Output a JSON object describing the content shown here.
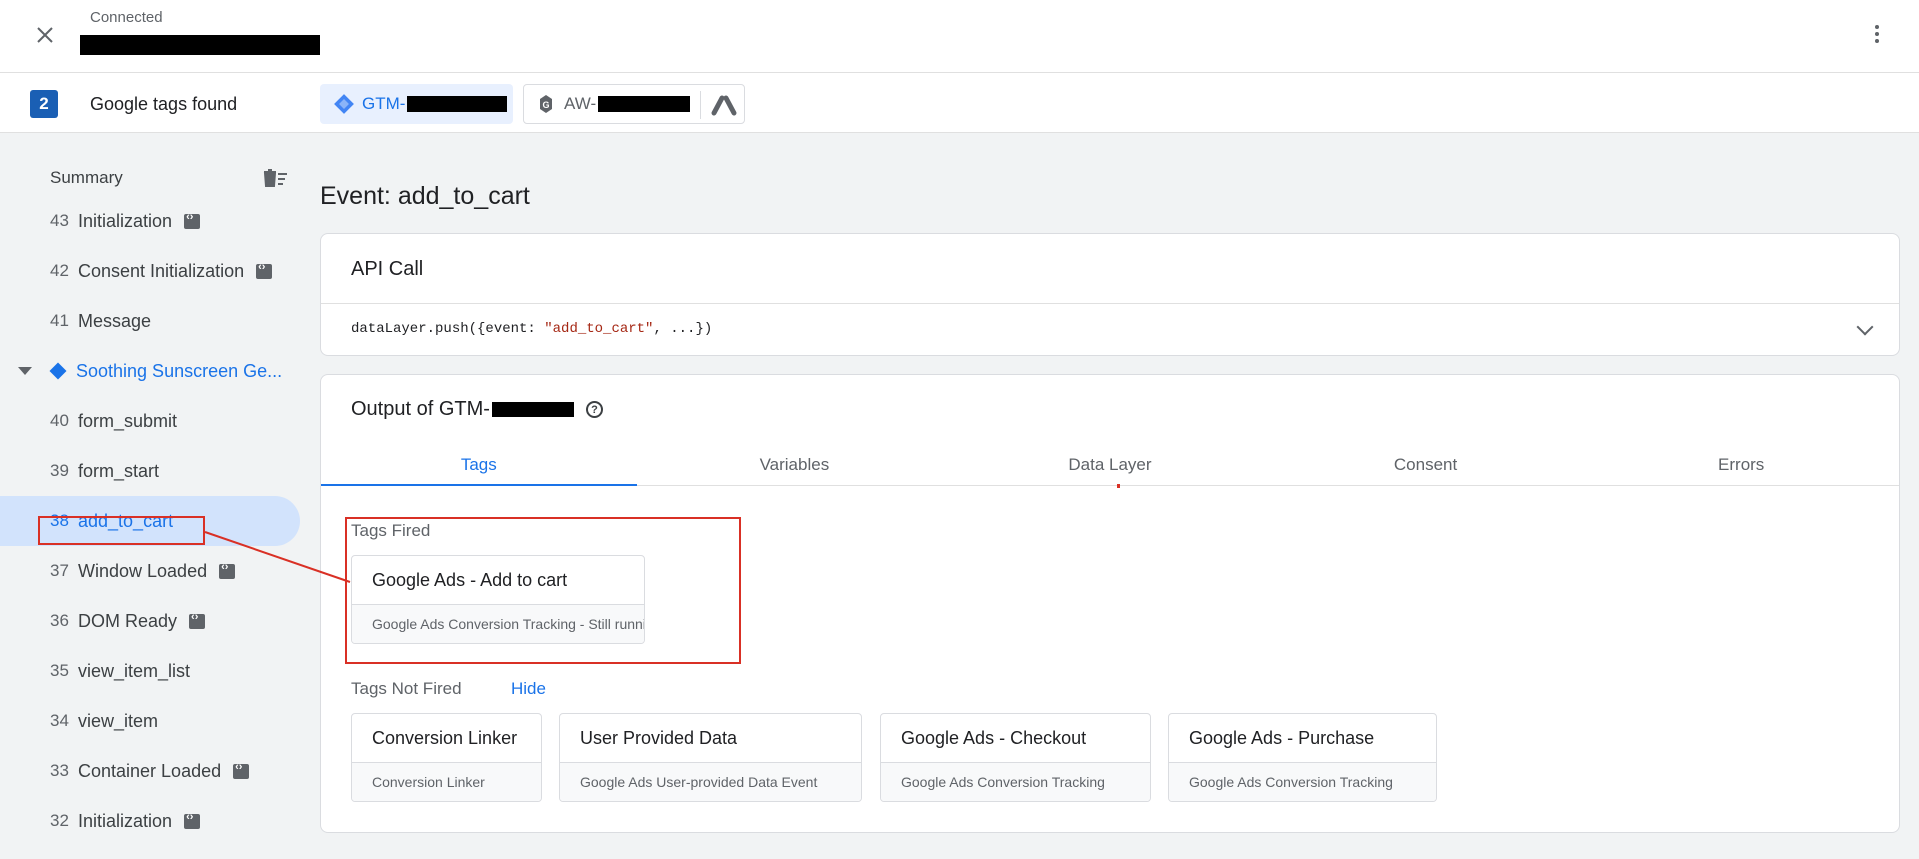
{
  "header": {
    "status": "Connected"
  },
  "tag_bar": {
    "count": "2",
    "label": "Google tags found",
    "chips": [
      {
        "prefix": "GTM-",
        "icon": "gtm-diamond-icon"
      },
      {
        "prefix": "AW-",
        "icon": "google-tag-icon",
        "extra_icon": "google-ads-icon"
      }
    ]
  },
  "sidebar": {
    "summary_label": "Summary",
    "items": [
      {
        "num": "43",
        "label": "Initialization",
        "api": true
      },
      {
        "num": "42",
        "label": "Consent Initialization",
        "api": true
      },
      {
        "num": "41",
        "label": "Message",
        "api": false
      },
      {
        "group_label": "Soothing Sunscreen Ge..."
      },
      {
        "num": "40",
        "label": "form_submit",
        "api": false
      },
      {
        "num": "39",
        "label": "form_start",
        "api": false
      },
      {
        "num": "38",
        "label": "add_to_cart",
        "api": false,
        "active": true
      },
      {
        "num": "37",
        "label": "Window Loaded",
        "api": true
      },
      {
        "num": "36",
        "label": "DOM Ready",
        "api": true
      },
      {
        "num": "35",
        "label": "view_item_list",
        "api": false
      },
      {
        "num": "34",
        "label": "view_item",
        "api": false
      },
      {
        "num": "33",
        "label": "Container Loaded",
        "api": true
      },
      {
        "num": "32",
        "label": "Initialization",
        "api": true
      }
    ]
  },
  "main": {
    "event_title": "Event: add_to_cart",
    "api_call": {
      "title": "API Call",
      "code_prefix": "dataLayer.push({event: ",
      "code_string": "\"add_to_cart\"",
      "code_suffix": ", ...})"
    },
    "output": {
      "title_prefix": "Output of GTM-",
      "tabs": [
        "Tags",
        "Variables",
        "Data Layer",
        "Consent",
        "Errors"
      ],
      "active_tab": "Tags",
      "fired_label": "Tags Fired",
      "fired": [
        {
          "name": "Google Ads - Add to cart",
          "type": "Google Ads Conversion Tracking - Still running"
        }
      ],
      "not_fired_label": "Tags Not Fired",
      "hide_label": "Hide",
      "not_fired": [
        {
          "name": "Conversion Linker",
          "type": "Conversion Linker"
        },
        {
          "name": "User Provided Data",
          "type": "Google Ads User-provided Data Event"
        },
        {
          "name": "Google Ads - Checkout",
          "type": "Google Ads Conversion Tracking"
        },
        {
          "name": "Google Ads - Purchase",
          "type": "Google Ads Conversion Tracking"
        }
      ]
    }
  },
  "colors": {
    "accent": "#1a73e8",
    "highlight": "#d93025"
  }
}
